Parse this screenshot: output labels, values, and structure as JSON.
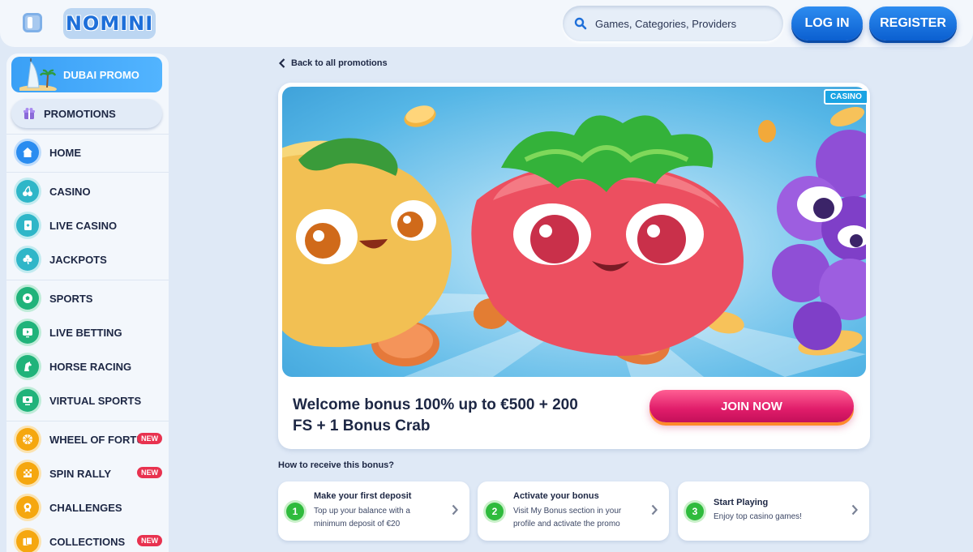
{
  "header": {
    "logo_text": "NOMINI",
    "search_placeholder": "Games, Categories, Providers",
    "login_label": "LOG IN",
    "register_label": "REGISTER"
  },
  "sidebar": {
    "promo_card_label": "DUBAI PROMO",
    "promotions_label": "PROMOTIONS",
    "items": [
      {
        "label": "HOME",
        "icon": "home-icon"
      },
      {
        "label": "CASINO",
        "icon": "cherries-icon"
      },
      {
        "label": "LIVE CASINO",
        "icon": "cards-icon"
      },
      {
        "label": "JACKPOTS",
        "icon": "clover-icon"
      },
      {
        "label": "SPORTS",
        "icon": "soccer-ball-icon"
      },
      {
        "label": "LIVE BETTING",
        "icon": "tv-play-icon"
      },
      {
        "label": "HORSE RACING",
        "icon": "horse-icon"
      },
      {
        "label": "VIRTUAL SPORTS",
        "icon": "monitor-icon"
      },
      {
        "label": "WHEEL OF FORTUNE",
        "icon": "wheel-icon",
        "badge": "NEW"
      },
      {
        "label": "SPIN RALLY",
        "icon": "flag-icon",
        "badge": "NEW"
      },
      {
        "label": "CHALLENGES",
        "icon": "medal-icon"
      },
      {
        "label": "COLLECTIONS",
        "icon": "collection-icon",
        "badge": "NEW"
      }
    ]
  },
  "main": {
    "back_label": "Back to all promotions",
    "banner_badge": "CASINO",
    "promo_title": "Welcome bonus 100% up to €500 + 200 FS + 1 Bonus Crab",
    "join_label": "JOIN NOW",
    "how_title": "How to receive this bonus?",
    "steps": [
      {
        "num": "1",
        "title": "Make your first deposit",
        "desc": "Top up your balance with a minimum deposit of €20"
      },
      {
        "num": "2",
        "title": "Activate your bonus",
        "desc": "Visit My Bonus section in your profile and activate the promo"
      },
      {
        "num": "3",
        "title": "Start Playing",
        "desc": "Enjoy top casino games!"
      }
    ]
  },
  "colors": {
    "accent_blue": "#1e6fd9",
    "join_pink": "#e01c6a",
    "step_green": "#2fbb3d",
    "background": "#dfe9f6"
  }
}
